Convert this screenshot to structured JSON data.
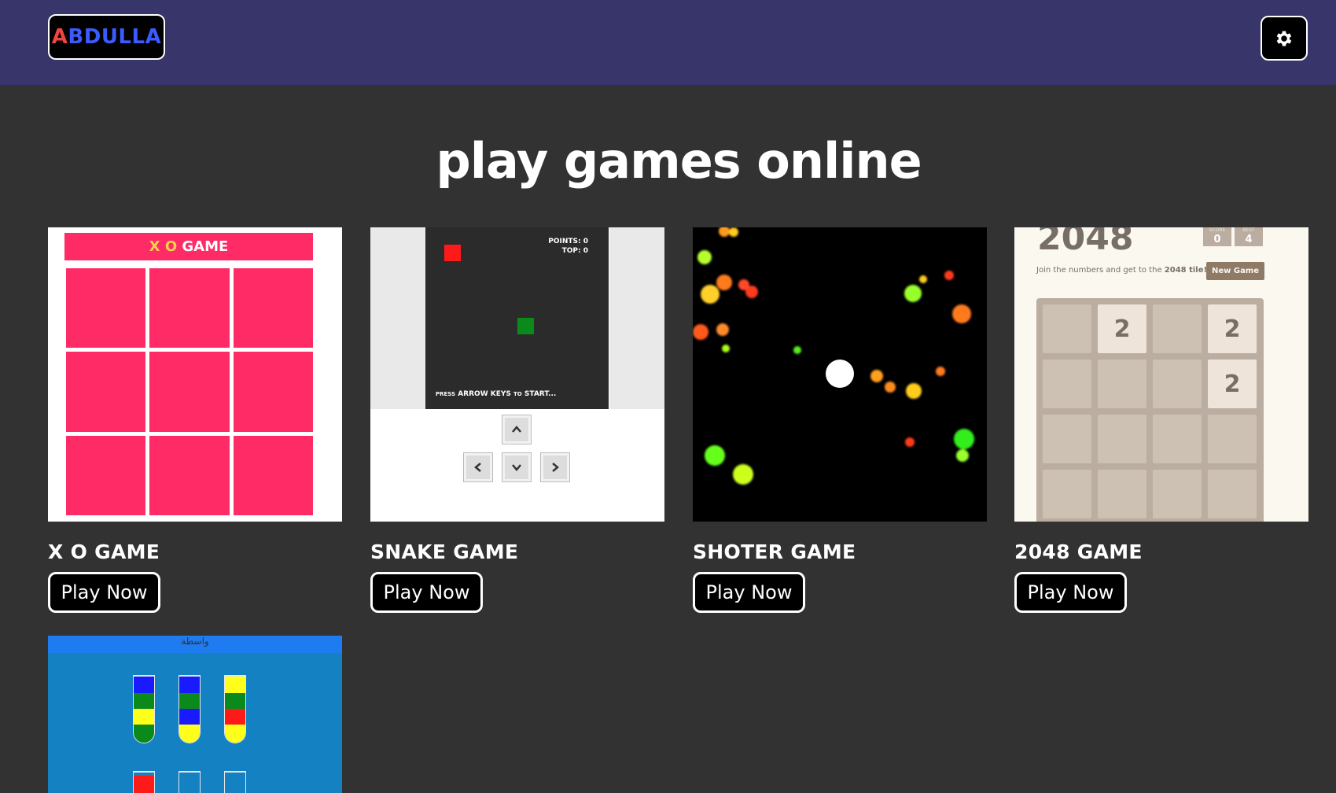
{
  "header": {
    "logo_first_letter": "A",
    "logo_rest": "BDULLA",
    "settings_icon": "gear-icon"
  },
  "page": {
    "title": "play games online"
  },
  "games": [
    {
      "title": "X O GAME",
      "button": "Play Now"
    },
    {
      "title": "SNAKE GAME",
      "button": "Play Now"
    },
    {
      "title": "SHOTER GAME",
      "button": "Play Now"
    },
    {
      "title": "2048 GAME",
      "button": "Play Now"
    }
  ],
  "thumbs": {
    "xo": {
      "header_letters": "X O",
      "header_word": "GAME"
    },
    "snake": {
      "points": "POINTS: 0",
      "top": "TOP: 0",
      "press": "PRESS",
      "arrow_keys": "ARROW KEYS",
      "to": "TO",
      "start": "START..."
    },
    "g2048": {
      "title": "2048",
      "score_label": "SCORE",
      "score_value": "0",
      "best_label": "BEST",
      "best_value": "4",
      "intro": "Join the numbers and get to the",
      "intro_bold": "2048 tile!",
      "new_game": "New Game",
      "tile_value": "2"
    },
    "water": {
      "title": "واسطة"
    }
  },
  "colors": {
    "header_bg": "#38356b",
    "page_bg": "#323232",
    "xo_pink": "#fe2b67",
    "water_blue": "#1482c2"
  }
}
